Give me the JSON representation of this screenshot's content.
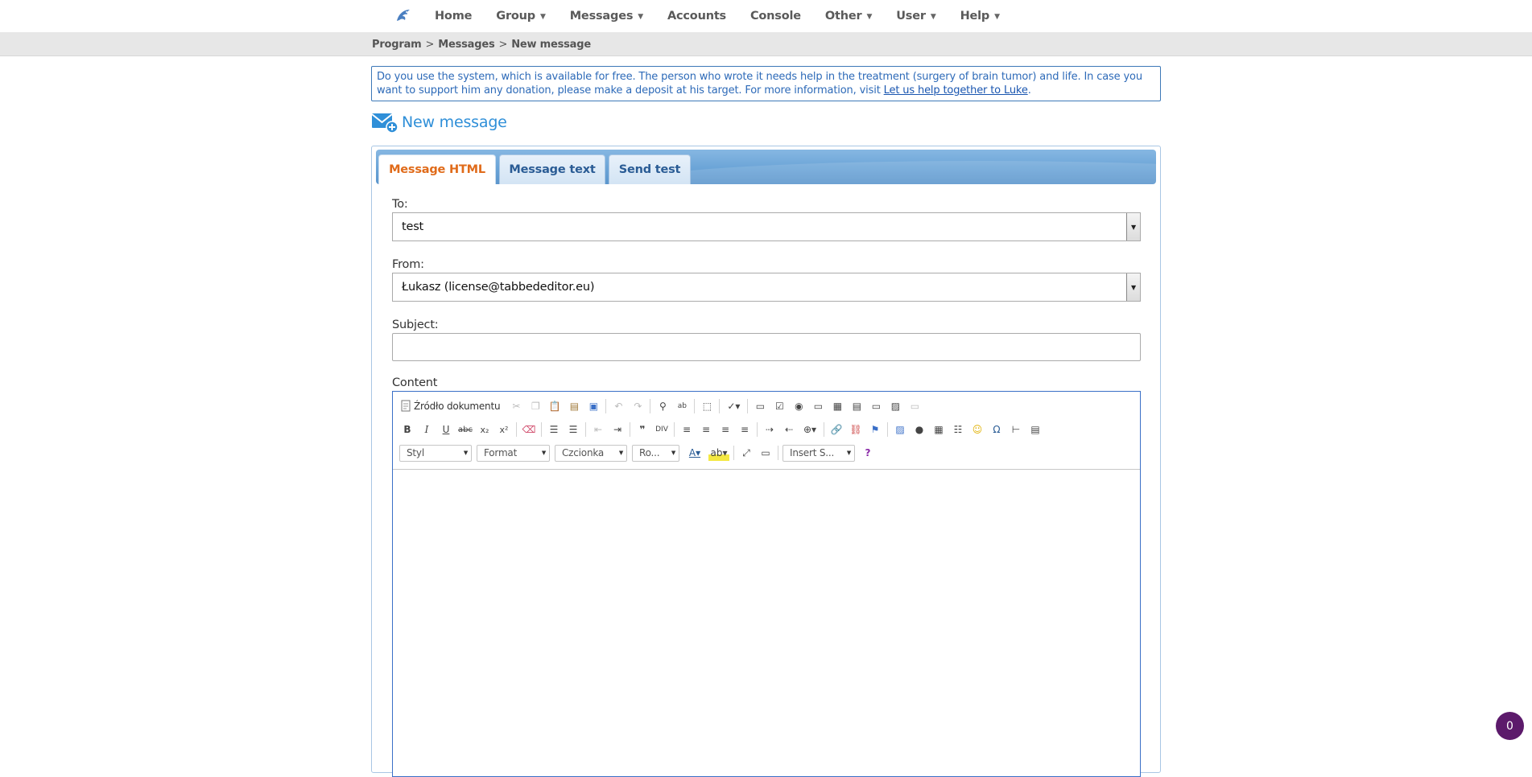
{
  "nav": {
    "items": [
      {
        "label": "Home",
        "has_caret": false
      },
      {
        "label": "Group",
        "has_caret": true
      },
      {
        "label": "Messages",
        "has_caret": true
      },
      {
        "label": "Accounts",
        "has_caret": false
      },
      {
        "label": "Console",
        "has_caret": false
      },
      {
        "label": "Other",
        "has_caret": true
      },
      {
        "label": "User",
        "has_caret": true
      },
      {
        "label": "Help",
        "has_caret": true
      }
    ],
    "logo_icon": "dolphin-logo-icon"
  },
  "breadcrumb": {
    "items": [
      "Program",
      "Messages",
      "New message"
    ],
    "separator": ">"
  },
  "notice": {
    "text": "Do you use the system, which is available for free. The person who wrote it needs help in the treatment (surgery of brain tumor) and life. In case you want to support him any donation, please make a deposit at his target. For more information, visit ",
    "link": "Let us help together to Luke",
    "end": "."
  },
  "page": {
    "title": "New message",
    "title_icon": "new-mail-icon"
  },
  "tabs": [
    {
      "label": "Message HTML",
      "active": true
    },
    {
      "label": "Message text",
      "active": false
    },
    {
      "label": "Send test",
      "active": false
    }
  ],
  "form": {
    "to_label": "To:",
    "to_value": "test",
    "from_label": "From:",
    "from_value": "Łukasz (license@tabbededitor.eu)",
    "subject_label": "Subject:",
    "subject_value": "",
    "content_label": "Content"
  },
  "editor": {
    "source_label": "Źródło dokumentu",
    "combos": {
      "style": "Styl",
      "format": "Format",
      "font": "Czcionka",
      "size": "Ro...",
      "insert": "Insert S..."
    }
  },
  "badge": {
    "count": "0"
  },
  "colors": {
    "accent": "#2f8fd8",
    "active_tab": "#e06b1a",
    "tab_bar": "#6ba4d7",
    "badge": "#5c1a6b"
  }
}
